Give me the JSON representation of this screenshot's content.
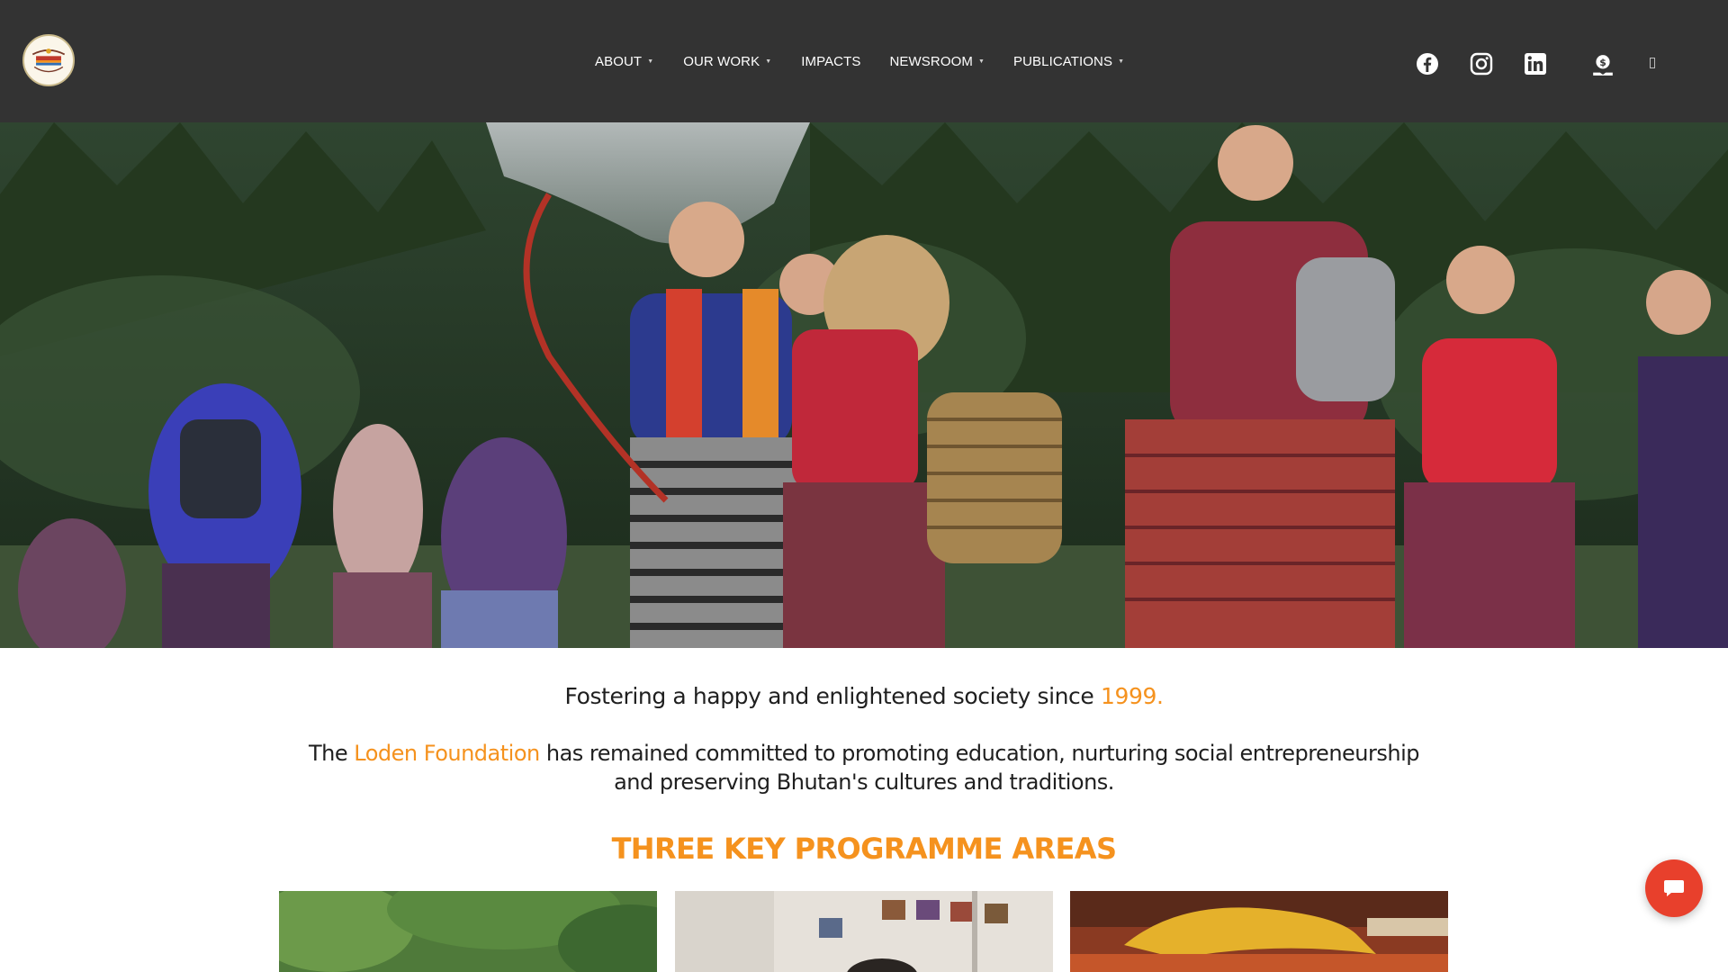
{
  "brand": {
    "logo_icon": "loden-foundation-logo",
    "logo_text": "Loden Foundation"
  },
  "nav": {
    "items": [
      {
        "label": "ABOUT",
        "has_dropdown": true
      },
      {
        "label": "OUR WORK",
        "has_dropdown": true
      },
      {
        "label": "IMPACTS",
        "has_dropdown": false
      },
      {
        "label": "NEWSROOM",
        "has_dropdown": true
      },
      {
        "label": "PUBLICATIONS",
        "has_dropdown": true
      }
    ],
    "dropdown_icon": "caret-down-icon"
  },
  "social": {
    "icons": [
      "facebook-icon",
      "instagram-icon",
      "linkedin-icon",
      "donate-icon",
      "search-icon"
    ]
  },
  "hero": {
    "image": "women-in-traditional-bhutanese-dress-dancing-outdoors"
  },
  "intro": {
    "tagline_text": "Fostering a happy and enlightened society since ",
    "tagline_year": "1999.",
    "mission_prefix": "The ",
    "mission_name": "Loden Foundation",
    "mission_text": " has remained committed to promoting education, nurturing social entrepreneurship and preserving Bhutan's cultures and traditions."
  },
  "programmes": {
    "title": "THREE KEY PROGRAMME AREAS",
    "cards": [
      {
        "image": "programme-image-forest"
      },
      {
        "image": "programme-image-classroom"
      },
      {
        "image": "programme-image-culture"
      }
    ]
  },
  "chat": {
    "icon": "chat-bubble-icon"
  },
  "colors": {
    "header_bg": "#333333",
    "accent": "#f5921e",
    "chat": "#e8402c"
  }
}
